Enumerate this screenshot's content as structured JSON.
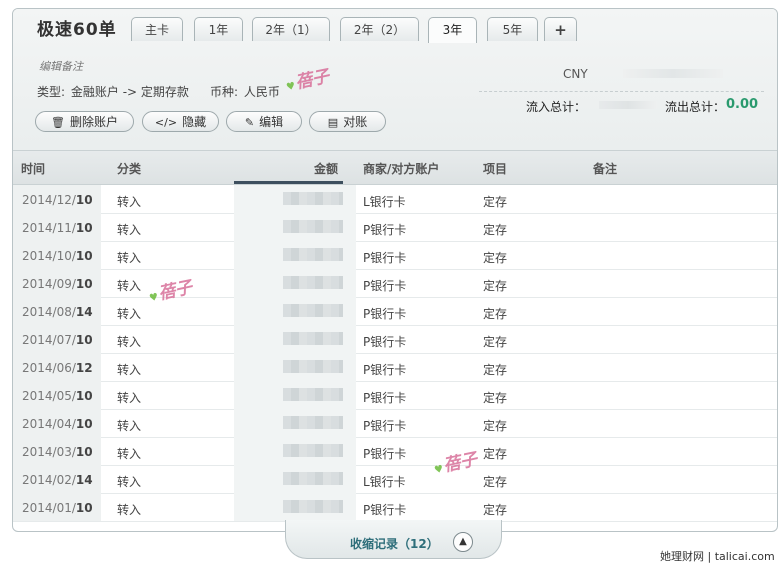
{
  "account": {
    "title": "极速60单",
    "remark_placeholder": "编辑备注",
    "type_label": "类型:",
    "type_value": "金融账户 -> 定期存款",
    "currency_label": "币种:",
    "currency_value": "人民币"
  },
  "tabs": [
    {
      "label": "主卡",
      "active": false
    },
    {
      "label": "1年",
      "active": false
    },
    {
      "label": "2年（1）",
      "active": false
    },
    {
      "label": "2年（2）",
      "active": false
    },
    {
      "label": "3年",
      "active": true
    },
    {
      "label": "5年",
      "active": false
    },
    {
      "label": "+",
      "active": false
    }
  ],
  "summary": {
    "currency": "CNY",
    "inflow_label": "流入总计：",
    "outflow_label": "流出总计：",
    "outflow_value": "0.00"
  },
  "buttons": {
    "delete": "删除账户",
    "hide": "隐藏",
    "edit": "编辑",
    "reconcile": "对账"
  },
  "table": {
    "headers": {
      "time": "时间",
      "category": "分类",
      "amount": "金额",
      "merchant": "商家/对方账户",
      "project": "项目",
      "note": "备注"
    },
    "rows": [
      {
        "ym": "2014/12/",
        "day": "10",
        "category": "转入",
        "merchant": "L银行卡",
        "project": "定存"
      },
      {
        "ym": "2014/11/",
        "day": "10",
        "category": "转入",
        "merchant": "P银行卡",
        "project": "定存"
      },
      {
        "ym": "2014/10/",
        "day": "10",
        "category": "转入",
        "merchant": "P银行卡",
        "project": "定存"
      },
      {
        "ym": "2014/09/",
        "day": "10",
        "category": "转入",
        "merchant": "P银行卡",
        "project": "定存"
      },
      {
        "ym": "2014/08/",
        "day": "14",
        "category": "转入",
        "merchant": "P银行卡",
        "project": "定存"
      },
      {
        "ym": "2014/07/",
        "day": "10",
        "category": "转入",
        "merchant": "P银行卡",
        "project": "定存"
      },
      {
        "ym": "2014/06/",
        "day": "12",
        "category": "转入",
        "merchant": "P银行卡",
        "project": "定存"
      },
      {
        "ym": "2014/05/",
        "day": "10",
        "category": "转入",
        "merchant": "P银行卡",
        "project": "定存"
      },
      {
        "ym": "2014/04/",
        "day": "10",
        "category": "转入",
        "merchant": "P银行卡",
        "project": "定存"
      },
      {
        "ym": "2014/03/",
        "day": "10",
        "category": "转入",
        "merchant": "P银行卡",
        "project": "定存"
      },
      {
        "ym": "2014/02/",
        "day": "14",
        "category": "转入",
        "merchant": "L银行卡",
        "project": "定存"
      },
      {
        "ym": "2014/01/",
        "day": "10",
        "category": "转入",
        "merchant": "P银行卡",
        "project": "定存"
      }
    ]
  },
  "footer": {
    "collapse_label": "收缩记录（12）"
  },
  "watermark": {
    "text": "蓓子"
  },
  "credit": {
    "text": "她理财网 | talicai.com"
  },
  "colors": {
    "accent_green": "#2a9a6e",
    "link_teal": "#2e6e7a",
    "watermark_pink": "#d8709a"
  }
}
